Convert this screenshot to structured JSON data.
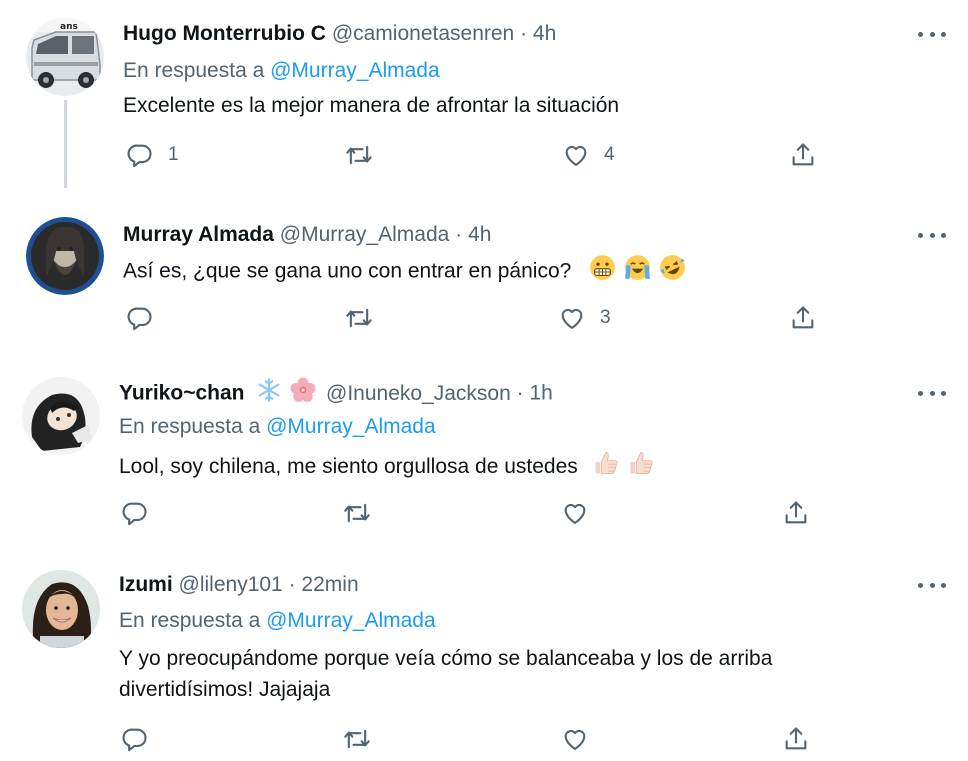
{
  "replies_label": "En respuesta a",
  "tweets": [
    {
      "name": "Hugo Monterrubio C",
      "handle": "@camionetasenren",
      "sep": "·",
      "time": "4h",
      "reply_to": "@Murray_Almada",
      "text": "Excelente es la mejor manera de afrontar la situación",
      "reply_count": "1",
      "retweet_count": "",
      "like_count": "4",
      "avatar_icon": "van-photo"
    },
    {
      "name": "Murray Almada",
      "handle": "@Murray_Almada",
      "sep": "·",
      "time": "4h",
      "reply_to": "",
      "text": "Así es, ¿que se gana uno con entrar en pánico?",
      "reply_count": "",
      "retweet_count": "",
      "like_count": "3",
      "avatar_icon": "bearded-man-photo",
      "emojis": [
        "grimacing-face-emoji",
        "loudly-crying-face-emoji",
        "rolling-laughing-emoji"
      ]
    },
    {
      "name": "Yuriko~chan",
      "handle": "@Inuneko_Jackson",
      "sep": "·",
      "time": "1h",
      "reply_to": "@Murray_Almada",
      "text": "Lool, soy chilena, me siento orgullosa de ustedes",
      "reply_count": "",
      "retweet_count": "",
      "like_count": "",
      "avatar_icon": "anime-girl-photo",
      "name_emojis": [
        "snowflake-emoji",
        "cherry-blossom-emoji"
      ],
      "emojis": [
        "thumbs-up-emoji",
        "thumbs-up-emoji"
      ]
    },
    {
      "name": "Izumi",
      "handle": "@lileny101",
      "sep": "·",
      "time": "22min",
      "reply_to": "@Murray_Almada",
      "text_line1": "Y yo preocupándome porque veía cómo se balanceaba y los de arriba",
      "text_line2": "divertidísimos! Jajajaja",
      "reply_count": "",
      "retweet_count": "",
      "like_count": "",
      "avatar_icon": "smiling-woman-photo"
    }
  ],
  "colors": {
    "text": "#0f1419",
    "secondary": "#536471",
    "link": "#1d9bf0",
    "thread": "#cfd9de"
  }
}
